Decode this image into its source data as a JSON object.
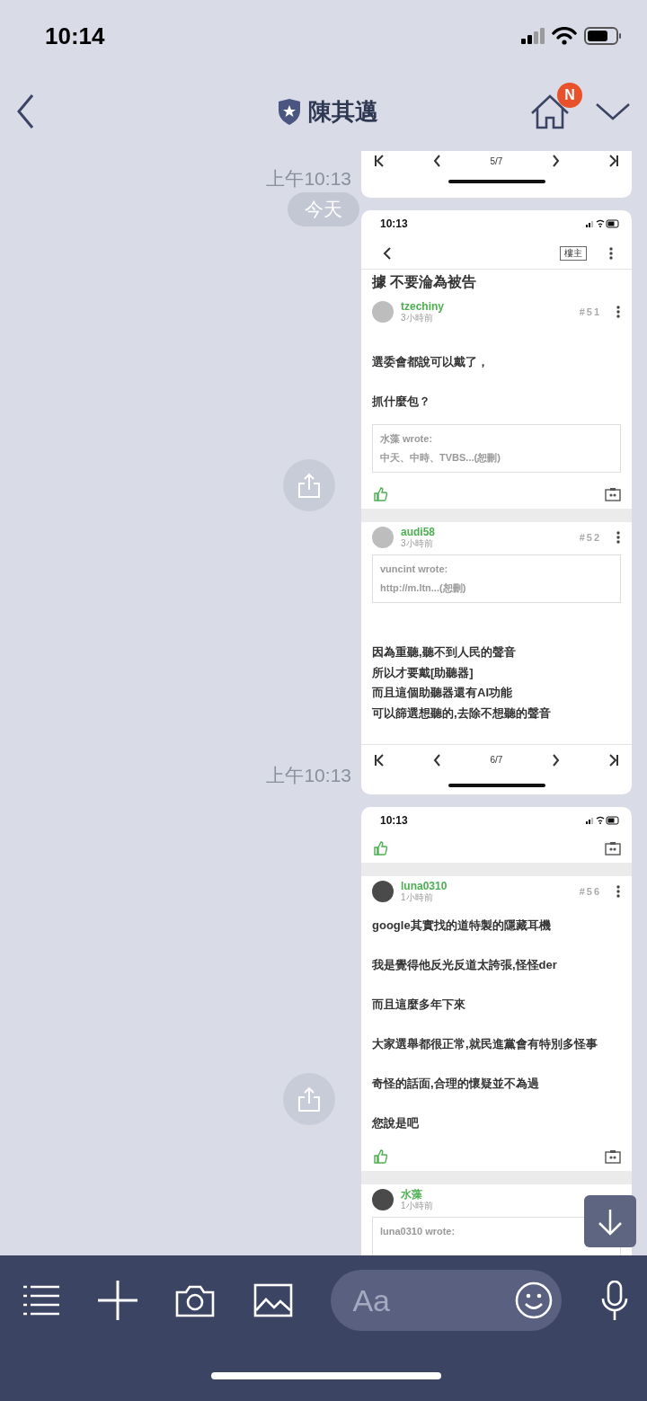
{
  "status_bar": {
    "time": "10:14"
  },
  "header": {
    "title": "陳其邁",
    "badge": "N"
  },
  "date_label": "今天",
  "composer": {
    "placeholder": "Aa"
  },
  "messages": [
    {
      "timestamp": "上午10:13",
      "share": false,
      "shot": {
        "pager": "5/7"
      }
    },
    {
      "timestamp": "上午10:13",
      "share": true,
      "shot": {
        "time": "10:13",
        "owner_tag": "樓主",
        "pager": "6/7",
        "items": [
          {
            "kind": "title",
            "text": "據 不要淪為被告"
          },
          {
            "kind": "post",
            "user": "tzechiny",
            "ago": "3小時前",
            "number": "#51",
            "photo_avatar": false
          },
          {
            "kind": "blank"
          },
          {
            "kind": "para",
            "text": "選委會都說可以戴了，"
          },
          {
            "kind": "para",
            "text": "抓什麼包？"
          },
          {
            "kind": "quote",
            "head": "水藻 wrote:",
            "text": "中天、中時、TVBS...(恕刪)"
          },
          {
            "kind": "actions"
          },
          {
            "kind": "gap"
          },
          {
            "kind": "post",
            "user": "audi58",
            "ago": "3小時前",
            "number": "#52",
            "photo_avatar": false
          },
          {
            "kind": "quote",
            "head": "vuncint wrote:",
            "text": "http://m.ltn...(恕刪)"
          },
          {
            "kind": "blank"
          },
          {
            "kind": "blank"
          },
          {
            "kind": "lines",
            "lines": [
              "因為重聽,聽不到人民的聲音",
              "所以才要戴[助聽器]",
              "而且這個助聽器還有AI功能",
              "可以篩選想聽的,去除不想聽的聲音"
            ]
          }
        ]
      }
    },
    {
      "share": true,
      "shot": {
        "time": "10:13",
        "items": [
          {
            "kind": "actions"
          },
          {
            "kind": "gap"
          },
          {
            "kind": "post",
            "user": "luna0310",
            "ago": "1小時前",
            "number": "#56",
            "photo_avatar": true
          },
          {
            "kind": "para",
            "text": "google其實找的道特製的隱藏耳機"
          },
          {
            "kind": "para",
            "text": "我是覺得他反光反道太誇張,怪怪der"
          },
          {
            "kind": "para",
            "text": "而且這麼多年下來"
          },
          {
            "kind": "para",
            "text": "大家選舉都很正常,就民進黨會有特別多怪事"
          },
          {
            "kind": "para",
            "text": "奇怪的話面,合理的懷疑並不為過"
          },
          {
            "kind": "para",
            "text": "您說是吧"
          },
          {
            "kind": "actions"
          },
          {
            "kind": "gap"
          },
          {
            "kind": "post",
            "user": "水藻",
            "ago": "1小時前",
            "photo_avatar": true
          },
          {
            "kind": "quote",
            "head": "luna0310 wrote:"
          }
        ]
      }
    }
  ]
}
